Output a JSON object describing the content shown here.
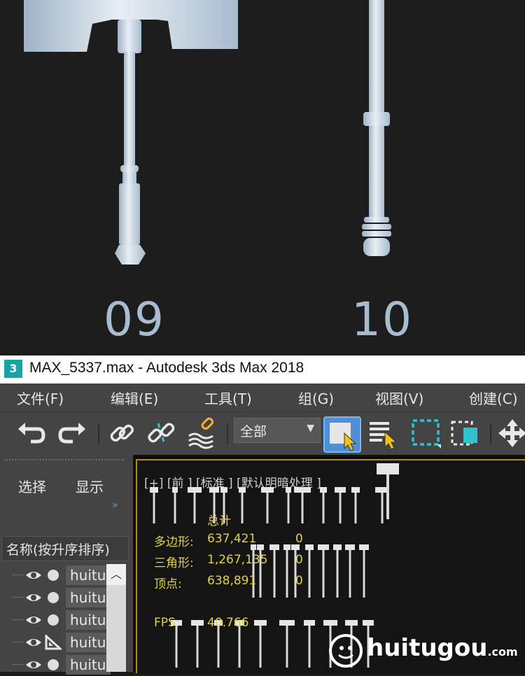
{
  "render": {
    "label_left": "09",
    "label_right": "10",
    "label_color": "#a9bccf"
  },
  "window": {
    "app_icon": "3",
    "title": "MAX_5337.max - Autodesk 3ds Max 2018"
  },
  "menu": {
    "items": [
      "文件(F)",
      "编辑(E)",
      "工具(T)",
      "组(G)",
      "视图(V)",
      "创建(C)"
    ]
  },
  "toolbar": {
    "icons": [
      "undo-icon",
      "redo-icon",
      "link-icon",
      "unlink-icon",
      "bind-spacewarp-icon",
      "select-object-icon",
      "select-by-name-icon",
      "rect-selection-region-icon",
      "window-crossing-icon",
      "move-icon"
    ],
    "selection_filter": "全部"
  },
  "scene_explorer": {
    "tabs": [
      "选择",
      "显示"
    ],
    "column_header": "名称(按升序排序)",
    "rows": [
      {
        "name": "huitu",
        "type_icon": "eye-icon"
      },
      {
        "name": "huitu",
        "type_icon": "eye-icon"
      },
      {
        "name": "huitu",
        "type_icon": "eye-icon"
      },
      {
        "name": "huitu",
        "type_icon": "camera-helper-icon"
      },
      {
        "name": "huitu",
        "type_icon": "eye-icon"
      }
    ]
  },
  "viewport": {
    "label": "[+] [前 ] [标准 ] [默认明暗处理 ]",
    "stats": {
      "total_label": "总计",
      "polys_label": "多边形:",
      "polys_value": "637,421",
      "polys_sel": "0",
      "tris_label": "三角形:",
      "tris_value": "1,267,135",
      "tris_sel": "0",
      "verts_label": "顶点:",
      "verts_value": "638,891",
      "verts_sel": "0",
      "fps_label": "FPS:",
      "fps_value": "40.766"
    },
    "accent": "#e2d43b"
  },
  "watermark": {
    "text": "huitugou",
    "suffix": ".com"
  }
}
